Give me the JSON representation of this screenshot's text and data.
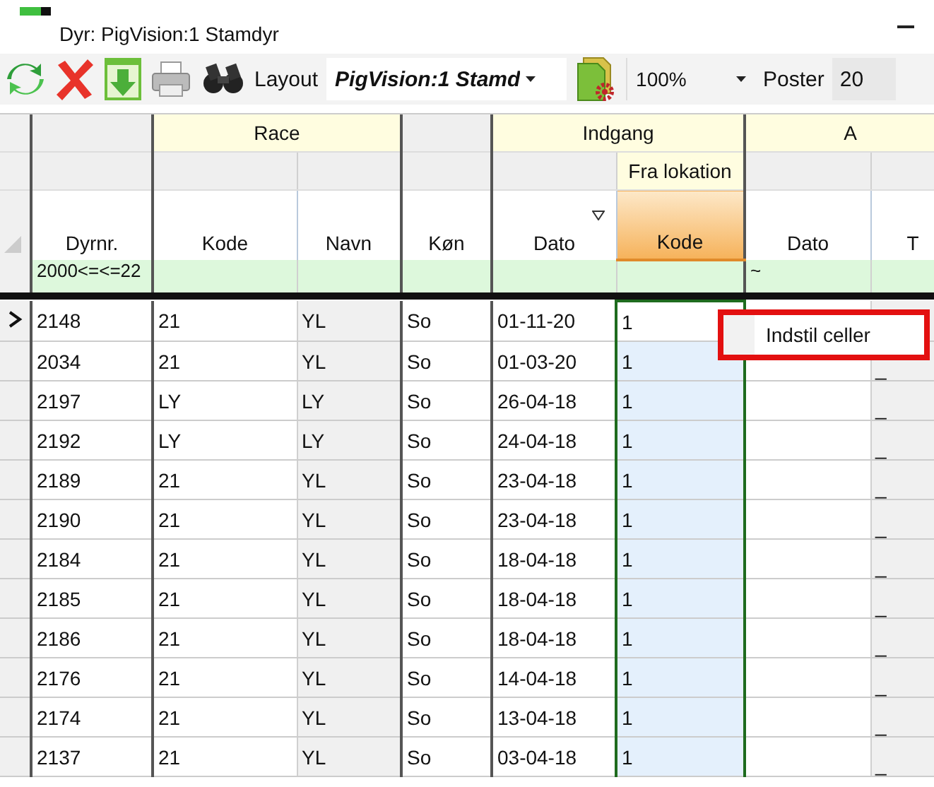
{
  "window": {
    "title": "Dyr: PigVision:1 Stamdyr"
  },
  "toolbar": {
    "layout_label": "Layout",
    "layout_value": "PigVision:1 Stamd",
    "zoom": "100%",
    "records_label": "Poster",
    "records_value": "20"
  },
  "groups": [
    {
      "columns": [
        {
          "name": "Dyrnr.",
          "filter": "2000<=<=22",
          "selected": false,
          "sorted": false
        }
      ]
    },
    {
      "label": "Race",
      "columns": [
        {
          "name": "Kode",
          "selected": false,
          "sorted": false
        },
        {
          "name": "Navn",
          "selected": false,
          "sorted": false
        }
      ]
    },
    {
      "columns": [
        {
          "name": "Køn",
          "selected": false,
          "sorted": false
        }
      ]
    },
    {
      "label": "Indgang",
      "columns": [
        {
          "name": "Dato",
          "selected": false,
          "sorted": true
        },
        {
          "name": "Kode",
          "sublabel": "Fra lokation",
          "selected": true,
          "sorted": false
        }
      ]
    },
    {
      "label": "A",
      "columns": [
        {
          "name": "Dato",
          "filter": "~",
          "selected": false,
          "sorted": false
        },
        {
          "name": "T",
          "selected": false,
          "sorted": false
        }
      ]
    }
  ],
  "rows": [
    {
      "current": true,
      "cells": [
        "2148",
        "21",
        "YL",
        "So",
        "01-11-20",
        "1"
      ]
    },
    {
      "current": false,
      "cells": [
        "2034",
        "21",
        "YL",
        "So",
        "01-03-20",
        "1"
      ],
      "column_8": "_"
    },
    {
      "current": false,
      "cells": [
        "2197",
        "LY",
        "LY",
        "So",
        "26-04-18",
        "1"
      ],
      "column_8": "_"
    },
    {
      "current": false,
      "cells": [
        "2192",
        "LY",
        "LY",
        "So",
        "24-04-18",
        "1"
      ],
      "column_8": "_"
    },
    {
      "current": false,
      "cells": [
        "2189",
        "21",
        "YL",
        "So",
        "23-04-18",
        "1"
      ],
      "column_8": "_"
    },
    {
      "current": false,
      "cells": [
        "2190",
        "21",
        "YL",
        "So",
        "23-04-18",
        "1"
      ],
      "column_8": "_"
    },
    {
      "current": false,
      "cells": [
        "2184",
        "21",
        "YL",
        "So",
        "18-04-18",
        "1"
      ],
      "column_8": "_"
    },
    {
      "current": false,
      "cells": [
        "2185",
        "21",
        "YL",
        "So",
        "18-04-18",
        "1"
      ],
      "column_8": "_"
    },
    {
      "current": false,
      "cells": [
        "2186",
        "21",
        "YL",
        "So",
        "18-04-18",
        "1"
      ],
      "column_8": "_"
    },
    {
      "current": false,
      "cells": [
        "2176",
        "21",
        "YL",
        "So",
        "14-04-18",
        "1"
      ],
      "column_8": "_"
    },
    {
      "current": false,
      "cells": [
        "2174",
        "21",
        "YL",
        "So",
        "13-04-18",
        "1"
      ],
      "column_8": "_"
    },
    {
      "current": false,
      "cells": [
        "2137",
        "21",
        "YL",
        "So",
        "03-04-18",
        "1"
      ],
      "column_8": "_"
    }
  ],
  "context_menu": {
    "items": [
      "Indstil celler"
    ]
  }
}
